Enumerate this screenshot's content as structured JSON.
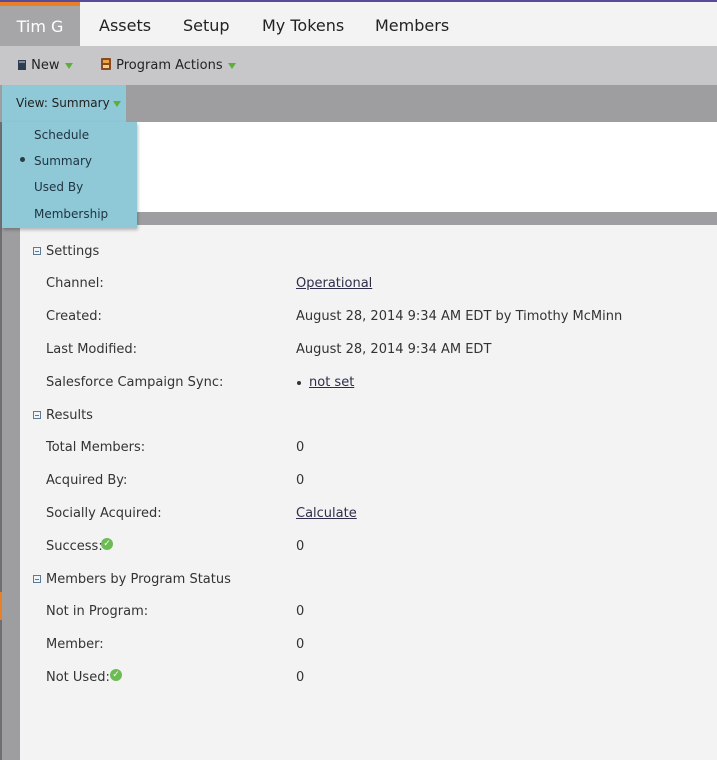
{
  "tabs": {
    "active": "Tim G",
    "items": [
      "Assets",
      "Setup",
      "My Tokens",
      "Members"
    ]
  },
  "toolbar": {
    "new_label": "New",
    "program_actions_label": "Program Actions"
  },
  "view": {
    "button_label": "View: Summary",
    "menu": [
      "Schedule",
      "Summary",
      "Used By",
      "Membership"
    ],
    "selected": "Summary"
  },
  "settings": {
    "heading": "Settings",
    "rows": [
      {
        "label": "Channel:",
        "value": "Operational"
      },
      {
        "label": "Created:",
        "value": "August 28, 2014 9:34 AM EDT by Timothy McMinn"
      },
      {
        "label": "Last Modified:",
        "value": "August 28, 2014 9:34 AM EDT"
      },
      {
        "label": "Salesforce Campaign Sync:",
        "value": "not set"
      }
    ]
  },
  "results": {
    "heading": "Results",
    "rows": [
      {
        "label": "Total Members:",
        "value": "0"
      },
      {
        "label": "Acquired By:",
        "value": "0"
      },
      {
        "label": "Socially Acquired:",
        "value": "Calculate"
      },
      {
        "label": "Success:",
        "value": "0"
      }
    ]
  },
  "members_status": {
    "heading": "Members by Program Status",
    "rows": [
      {
        "label": "Not in Program:",
        "value": "0"
      },
      {
        "label": "Member:",
        "value": "0"
      },
      {
        "label": "Not Used:",
        "value": "0"
      }
    ]
  },
  "colors": {
    "accent_orange": "#e98027",
    "menu_blue": "#8fc8d6",
    "check_green": "#6dbb54"
  },
  "icons": [
    "new-document-icon",
    "program-actions-icon",
    "collapse-icon",
    "check-circle-icon"
  ]
}
